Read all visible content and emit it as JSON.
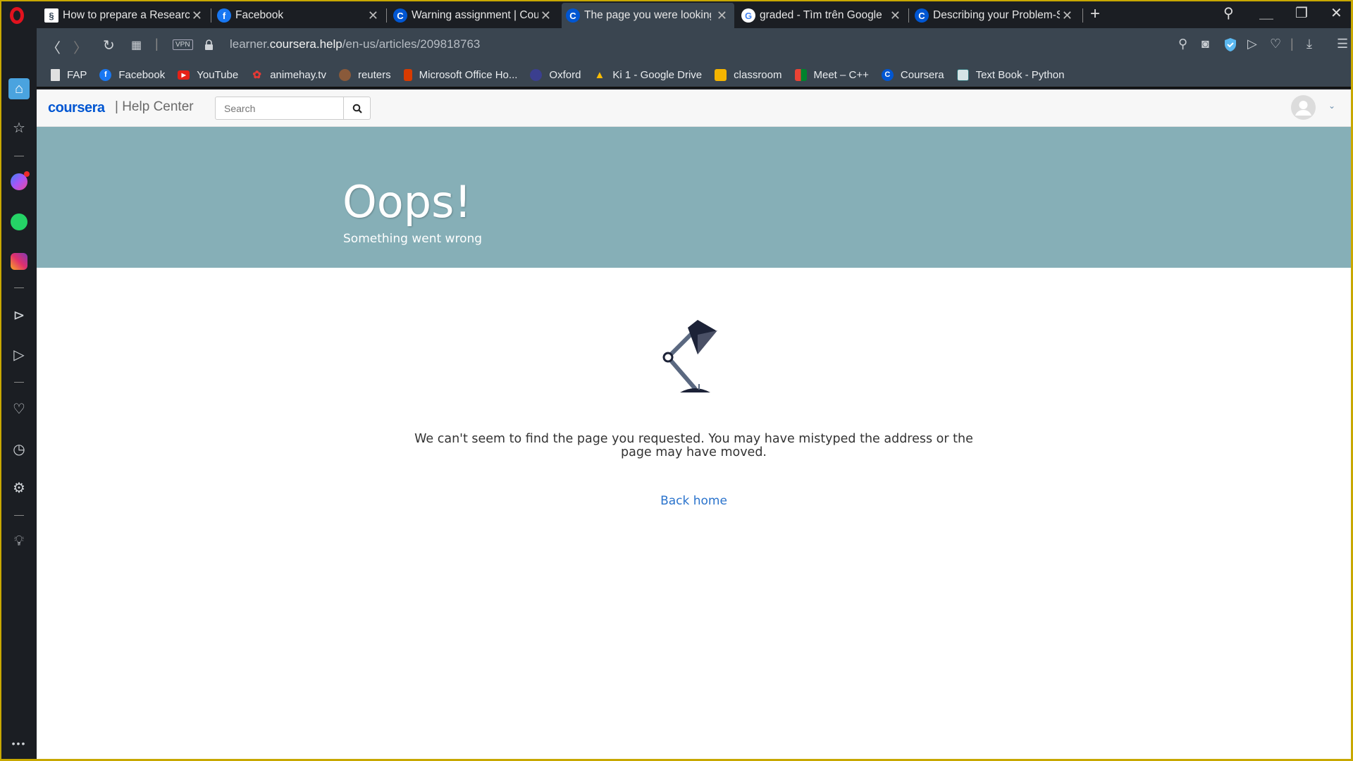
{
  "browser": {
    "tabs": [
      {
        "title": "How to prepare a Research",
        "icon": "research-favicon",
        "active": false
      },
      {
        "title": "Facebook",
        "icon": "facebook-favicon",
        "active": false
      },
      {
        "title": "Warning assignment | Cour",
        "icon": "coursera-favicon",
        "active": false
      },
      {
        "title": "The page you were looking",
        "icon": "coursera-favicon",
        "active": true
      },
      {
        "title": "graded - Tìm trên Google",
        "icon": "google-favicon",
        "active": false
      },
      {
        "title": "Describing your Problem-S",
        "icon": "coursera-favicon",
        "active": false
      }
    ],
    "new_tab": "+",
    "address": {
      "prefix": "learner.",
      "domain": "coursera.help",
      "path": "/en-us/articles/209818763",
      "vpn_label": "VPN"
    },
    "bookmarks": [
      {
        "label": "FAP",
        "icon": "file-icon"
      },
      {
        "label": "Facebook",
        "icon": "facebook-icon"
      },
      {
        "label": "YouTube",
        "icon": "youtube-icon"
      },
      {
        "label": "animehay.tv",
        "icon": "animehay-icon"
      },
      {
        "label": "reuters",
        "icon": "reuters-icon"
      },
      {
        "label": "Microsoft Office Ho...",
        "icon": "office-icon"
      },
      {
        "label": "Oxford",
        "icon": "oxford-icon"
      },
      {
        "label": "Ki 1 - Google Drive",
        "icon": "google-drive-icon"
      },
      {
        "label": "classroom",
        "icon": "classroom-icon"
      },
      {
        "label": "Meet – C++",
        "icon": "meet-icon"
      },
      {
        "label": "Coursera",
        "icon": "coursera-icon"
      },
      {
        "label": "Text Book - Python",
        "icon": "textbook-icon"
      }
    ],
    "sidebar": [
      "home",
      "bookmarks",
      "messenger",
      "whatsapp",
      "instagram",
      "player",
      "flow",
      "my-flow",
      "history",
      "settings",
      "tips",
      "more"
    ]
  },
  "page": {
    "logo": "coursera",
    "section": "| Help Center",
    "search_placeholder": "Search",
    "banner_title": "Oops!",
    "banner_subtitle": "Something went wrong",
    "message": "We can't seem to find the page you requested. You may have mistyped the address or the page may have moved.",
    "back_link": "Back home"
  },
  "colors": {
    "banner": "#86afb7",
    "link": "#2a73cc",
    "brand": "#0056d2",
    "window_border": "#c8a800"
  }
}
